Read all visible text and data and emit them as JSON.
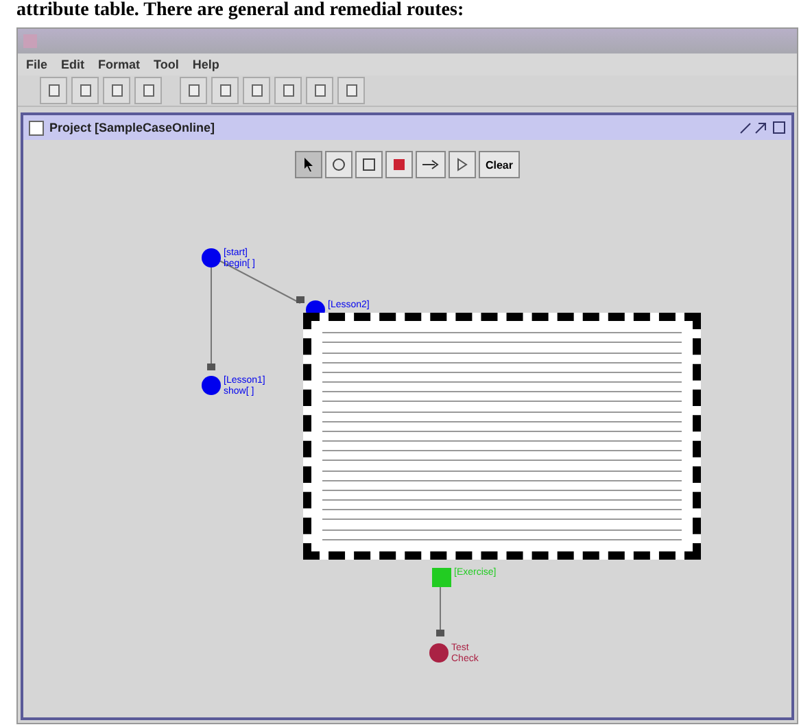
{
  "caption": "attribute table. There are general and remedial routes:",
  "menu": [
    "File",
    "Edit",
    "Format",
    "Tool",
    "Help"
  ],
  "inner_window": {
    "title": "Project [SampleCaseOnline]",
    "checked": false
  },
  "palette": [
    {
      "kind": "pointer",
      "selected": true
    },
    {
      "kind": "circle",
      "selected": false
    },
    {
      "kind": "square",
      "selected": false
    },
    {
      "kind": "stop",
      "selected": false
    },
    {
      "kind": "link",
      "selected": false
    },
    {
      "kind": "play",
      "selected": false
    },
    {
      "kind": "clear",
      "label": "Clear",
      "selected": false
    }
  ],
  "nodes": [
    {
      "kind": "circle",
      "color": "#0000ee",
      "label": "[start]",
      "sublabel": "begin[ ]"
    },
    {
      "kind": "circle",
      "color": "#0000ee",
      "label": "[Lesson2]"
    },
    {
      "kind": "circle",
      "color": "#0000ee",
      "label": "[Lesson1]",
      "sublabel": "show[ ]"
    },
    {
      "kind": "square",
      "color": "#22cc22",
      "label": "[Exercise]"
    },
    {
      "kind": "circle",
      "color": "#aa2244",
      "label": "Test",
      "sublabel": "Check"
    }
  ]
}
